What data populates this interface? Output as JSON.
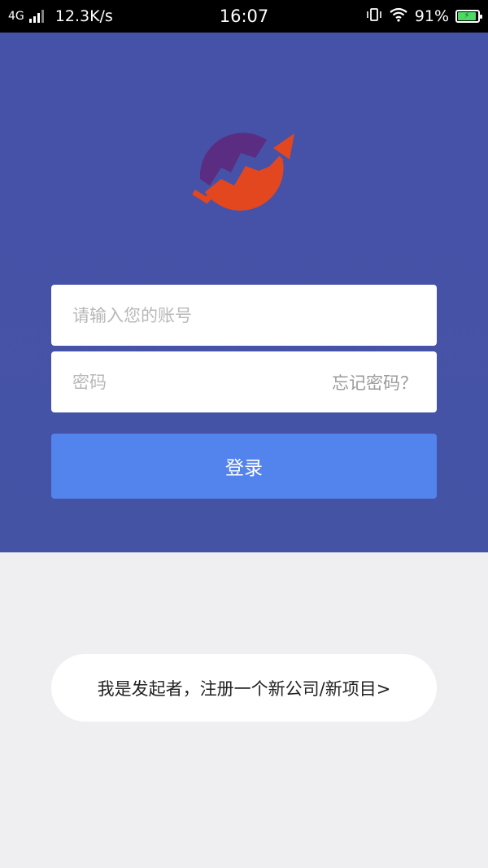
{
  "status_bar": {
    "network_type": "4G",
    "speed": "12.3K/s",
    "time": "16:07",
    "battery_percent": "91%",
    "battery_level": 0.91,
    "icons": [
      "signal-icon",
      "vibrate-icon",
      "wifi-icon",
      "battery-icon"
    ]
  },
  "login": {
    "account_placeholder": "请输入您的账号",
    "password_placeholder": "密码",
    "forgot_password": "忘记密码？",
    "login_button": "登录"
  },
  "register": {
    "label": "我是发起者，注册一个新公司/新项目>"
  },
  "colors": {
    "header_bg": "#4652a8",
    "primary_button": "#5383ec",
    "page_bg": "#efeff1",
    "logo_purple": "#5a2d82",
    "logo_orange": "#e2471f"
  }
}
